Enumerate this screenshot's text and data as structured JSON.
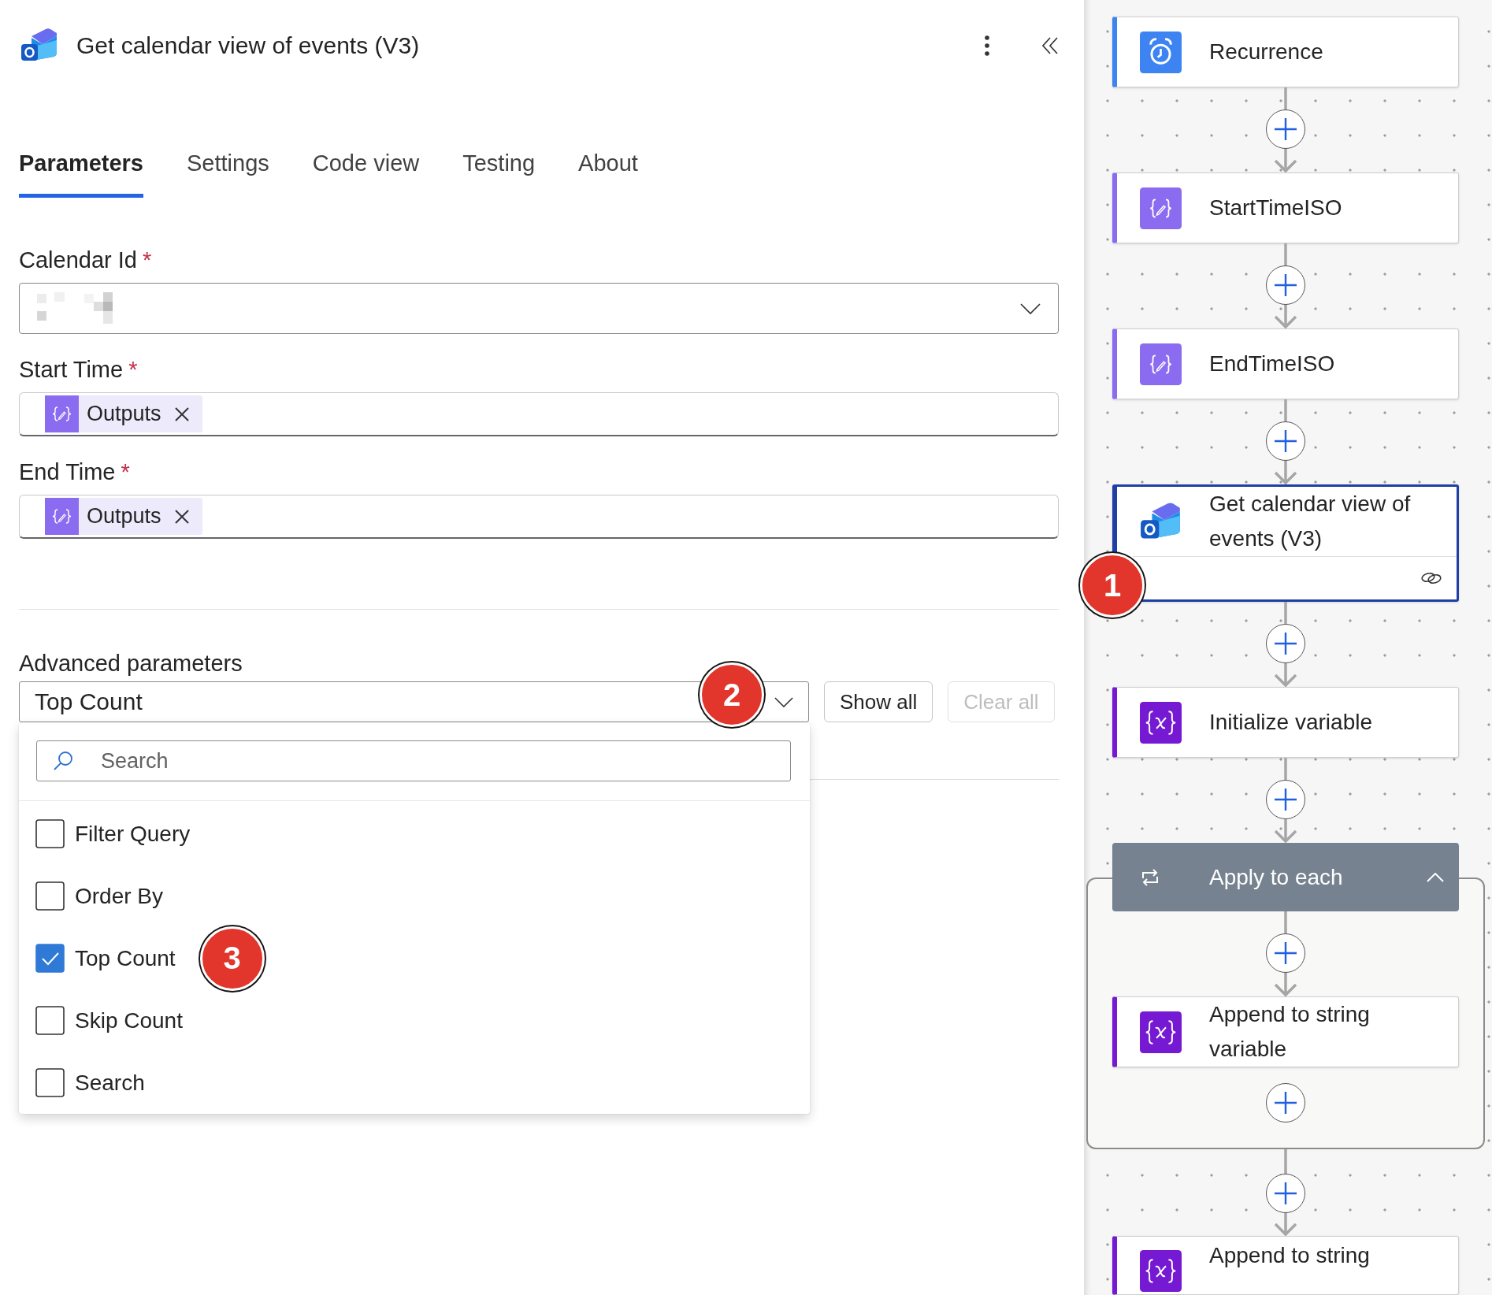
{
  "panel": {
    "title": "Get calendar view of events (V3)",
    "tabs": [
      {
        "label": "Parameters",
        "selected": true
      },
      {
        "label": "Settings",
        "selected": false
      },
      {
        "label": "Code view",
        "selected": false
      },
      {
        "label": "Testing",
        "selected": false
      },
      {
        "label": "About",
        "selected": false
      }
    ],
    "fields": [
      {
        "label": "Calendar Id",
        "required_mark": "*",
        "kind": "dropdown",
        "redacted": true
      },
      {
        "label": "Start Time",
        "required_mark": "*",
        "kind": "tokens",
        "tokens": [
          {
            "label": "Outputs"
          }
        ]
      },
      {
        "label": "End Time",
        "required_mark": "*",
        "kind": "tokens",
        "tokens": [
          {
            "label": "Outputs"
          }
        ]
      }
    ],
    "advanced": {
      "label": "Advanced parameters",
      "value": "Top Count",
      "callout": "2",
      "expanded": true,
      "buttons": [
        {
          "label": "Show all",
          "disabled": false
        },
        {
          "label": "Clear all",
          "disabled": true
        }
      ],
      "menu": {
        "search_placeholder": "Search",
        "options": [
          {
            "label": "Filter Query",
            "checked": false
          },
          {
            "label": "Order By",
            "checked": false
          },
          {
            "label": "Top Count",
            "checked": true,
            "callout": "3"
          },
          {
            "label": "Skip Count",
            "checked": false
          },
          {
            "label": "Search",
            "checked": false
          }
        ]
      }
    }
  },
  "flow": {
    "steps": [
      {
        "kind": "schedule",
        "title": "Recurrence",
        "color": "#3d84f2",
        "selected": false,
        "connection": false
      },
      {
        "kind": "compose",
        "title": "StartTimeISO",
        "color": "#8b6cf0",
        "selected": false,
        "connection": false
      },
      {
        "kind": "compose",
        "title": "EndTimeISO",
        "color": "#8b6cf0",
        "selected": false,
        "connection": false
      },
      {
        "kind": "connector",
        "title": "Get calendar view of events (V3)",
        "color": "#1f3fa6",
        "selected": true,
        "connection": true,
        "callout": "1"
      },
      {
        "kind": "variable",
        "title": "Initialize variable",
        "color": "#7519d2",
        "selected": false,
        "connection": false
      },
      {
        "kind": "loop",
        "title": "Apply to each",
        "expanded": true,
        "children": [
          {
            "kind": "variable",
            "title": "Append to string variable",
            "color": "#7519d2",
            "selected": false,
            "connection": false
          }
        ]
      },
      {
        "kind": "variable",
        "title": "Append to string",
        "color": "#7519d2",
        "selected": false,
        "connection": false
      }
    ]
  }
}
